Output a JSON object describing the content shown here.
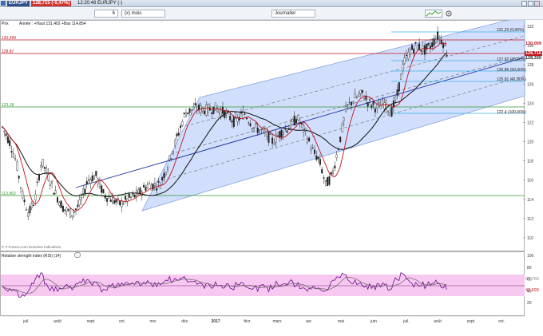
{
  "window": {
    "symbol": "EURJPY",
    "price_change": "128,715 (-0,47%)",
    "time_symbol": "12:20:48 EURJPY (-)"
  },
  "toolbar": {
    "period_value": "6",
    "period_unit": "(x) mois",
    "interval": "Journalier"
  },
  "price_panel": {
    "header": "Prix",
    "info": "Année : +Haut 131,402 +Bas 114,854",
    "copyright": "© F-France.com Données indicatives",
    "y_ticks": [
      "132",
      "130",
      "128",
      "126",
      "124",
      "122",
      "120",
      "118",
      "116",
      "114",
      "112",
      "110"
    ],
    "levels": [
      {
        "label": "130,499",
        "color": "#c0141c"
      },
      {
        "label": "128,87",
        "color": "#c0141c"
      },
      {
        "label": "123,18",
        "color": "#2e9a2e"
      },
      {
        "label": "113,963",
        "color": "#2e9a2e"
      }
    ],
    "fibo": [
      {
        "label": "131,23 (0,00%)"
      },
      {
        "label": "127,92 (38,20%)"
      },
      {
        "label": "126,86 (50,00%)"
      },
      {
        "label": "125,81 (61,80%)"
      },
      {
        "label": "122,4 (100,00%)"
      }
    ],
    "right_tags": [
      {
        "label": "130,009",
        "color": "#c0141c"
      },
      {
        "label": "128,715",
        "color": "#c0141c"
      },
      {
        "label": "128,330",
        "color": "#222222"
      }
    ]
  },
  "rsi_panel": {
    "header": "Relative strength index (RSI) (14)",
    "y_ticks": [
      "100",
      "80",
      "60",
      "40",
      "20"
    ],
    "tags": [
      {
        "label": "55,760",
        "color": "#888888"
      },
      {
        "label": "42,693",
        "color": "#c0141c"
      }
    ]
  },
  "x_axis": {
    "labels": [
      "juil.",
      "août",
      "sept.",
      "oct.",
      "nov.",
      "déc.",
      "2017",
      "févr.",
      "mars",
      "avr.",
      "mai",
      "juin",
      "juil.",
      "août",
      "sept.",
      "oct."
    ]
  },
  "colors": {
    "channel_fill": "#c9d8fb",
    "price_line": "#222222",
    "mm_fast": "#c0141c",
    "mm_slow": "#111111",
    "rsi_band": "#f7c9f1"
  },
  "chart_data": {
    "type": "line",
    "ylim": [
      109,
      133
    ],
    "series": [],
    "rsi_ylim": [
      0,
      100
    ]
  }
}
